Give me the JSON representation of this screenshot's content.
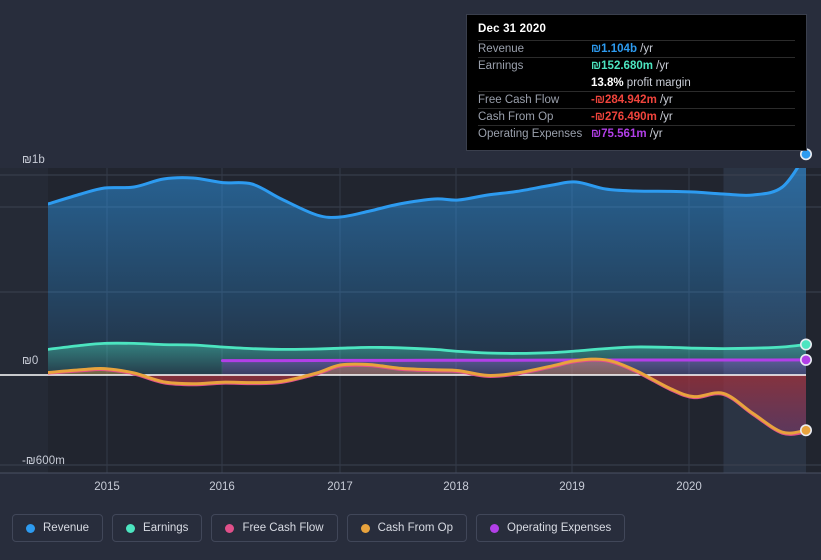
{
  "tooltip": {
    "date": "Dec 31 2020",
    "rows": [
      {
        "key": "Revenue",
        "value": "₪1.104b",
        "unit": "/yr",
        "color": "#2D9BF0"
      },
      {
        "key": "Earnings",
        "value": "₪152.680m",
        "unit": "/yr",
        "color": "#4CE5C0"
      },
      {
        "key": "",
        "value": "13.8%",
        "unit": "profit margin",
        "color": "#FFFFFF"
      },
      {
        "key": "Free Cash Flow",
        "value": "-₪284.942m",
        "unit": "/yr",
        "color": "#F0443C"
      },
      {
        "key": "Cash From Op",
        "value": "-₪276.490m",
        "unit": "/yr",
        "color": "#F0443C"
      },
      {
        "key": "Operating Expenses",
        "value": "₪75.561m",
        "unit": "/yr",
        "color": "#B23FE8"
      }
    ]
  },
  "legend": {
    "items": [
      {
        "label": "Revenue",
        "color": "#2D9BF0"
      },
      {
        "label": "Earnings",
        "color": "#4CE5C0"
      },
      {
        "label": "Free Cash Flow",
        "color": "#E0508A"
      },
      {
        "label": "Cash From Op",
        "color": "#E8A33D"
      },
      {
        "label": "Operating Expenses",
        "color": "#B23FE8"
      }
    ]
  },
  "chart_data": {
    "type": "area",
    "title": "",
    "xlabel": "",
    "ylabel": "",
    "grid": true,
    "legend_position": "bottom",
    "y_ticks": [
      {
        "label": "₪1b",
        "value": 1000
      },
      {
        "label": "₪0",
        "value": 0
      },
      {
        "label": "-₪600m",
        "value": -600
      }
    ],
    "ylim": [
      -700,
      1100
    ],
    "x_ticks": [
      "2015",
      "2016",
      "2017",
      "2018",
      "2019",
      "2020"
    ],
    "xlim": [
      "2014.6",
      "2021.1"
    ],
    "highlight_from": "2020.35",
    "units": "millions of ₪ per year",
    "series": [
      {
        "name": "Revenue",
        "color": "#2D9BF0",
        "fill": true,
        "x": [
          2014.62,
          2014.9,
          2015.1,
          2015.35,
          2015.6,
          2015.85,
          2016.1,
          2016.35,
          2016.6,
          2016.9,
          2017.1,
          2017.35,
          2017.6,
          2017.9,
          2018.1,
          2018.35,
          2018.6,
          2018.9,
          2019.1,
          2019.35,
          2019.6,
          2019.9,
          2020.1,
          2020.35,
          2020.6,
          2020.85,
          2021.05
        ],
        "values": [
          855,
          905,
          935,
          940,
          980,
          985,
          962,
          955,
          880,
          800,
          790,
          820,
          855,
          880,
          875,
          900,
          918,
          950,
          965,
          930,
          920,
          918,
          915,
          905,
          900,
          940,
          1104
        ]
      },
      {
        "name": "Earnings",
        "color": "#4CE5C0",
        "fill": true,
        "x": [
          2014.62,
          2014.9,
          2015.1,
          2015.35,
          2015.6,
          2015.85,
          2016.1,
          2016.35,
          2016.6,
          2016.9,
          2017.1,
          2017.35,
          2017.6,
          2017.9,
          2018.1,
          2018.35,
          2018.6,
          2018.9,
          2019.1,
          2019.35,
          2019.6,
          2019.9,
          2020.1,
          2020.35,
          2020.6,
          2020.85,
          2021.05
        ],
        "values": [
          128,
          148,
          158,
          158,
          152,
          150,
          140,
          132,
          128,
          130,
          134,
          138,
          136,
          128,
          118,
          110,
          108,
          112,
          120,
          132,
          140,
          138,
          134,
          132,
          134,
          140,
          152.68
        ]
      },
      {
        "name": "Free Cash Flow",
        "color": "#E0508A",
        "fill": false,
        "x": [
          2014.62,
          2014.9,
          2015.1,
          2015.35,
          2015.6,
          2015.85,
          2016.1,
          2016.35,
          2016.6,
          2016.9,
          2017.1,
          2017.35,
          2017.6,
          2017.9,
          2018.1,
          2018.35,
          2018.6,
          2018.9,
          2019.1,
          2019.35,
          2019.6,
          2019.9,
          2020.1,
          2020.35,
          2020.6,
          2020.85,
          2021.05
        ],
        "values": [
          10,
          22,
          28,
          6,
          -38,
          -48,
          -40,
          -42,
          -36,
          6,
          45,
          48,
          30,
          22,
          18,
          -6,
          6,
          42,
          68,
          72,
          20,
          -72,
          -112,
          -96,
          -196,
          -290,
          -284.942
        ]
      },
      {
        "name": "Cash From Op",
        "color": "#E8A33D",
        "fill": true,
        "x": [
          2014.62,
          2014.9,
          2015.1,
          2015.35,
          2015.6,
          2015.85,
          2016.1,
          2016.35,
          2016.6,
          2016.9,
          2017.1,
          2017.35,
          2017.6,
          2017.9,
          2018.1,
          2018.35,
          2018.6,
          2018.9,
          2019.1,
          2019.35,
          2019.6,
          2019.9,
          2020.1,
          2020.35,
          2020.6,
          2020.85,
          2021.05
        ],
        "values": [
          12,
          26,
          32,
          10,
          -34,
          -44,
          -36,
          -38,
          -32,
          10,
          50,
          52,
          34,
          26,
          22,
          -2,
          10,
          46,
          72,
          76,
          24,
          -68,
          -108,
          -92,
          -192,
          -286,
          -276.49
        ]
      },
      {
        "name": "Operating Expenses",
        "color": "#B23FE8",
        "fill": false,
        "x": [
          2016.1,
          2016.6,
          2017.1,
          2017.6,
          2018.1,
          2018.6,
          2019.1,
          2019.6,
          2020.1,
          2020.6,
          2021.05
        ],
        "values": [
          72,
          72,
          73,
          73,
          74,
          74,
          75,
          75,
          75,
          75,
          75.561
        ]
      }
    ]
  }
}
